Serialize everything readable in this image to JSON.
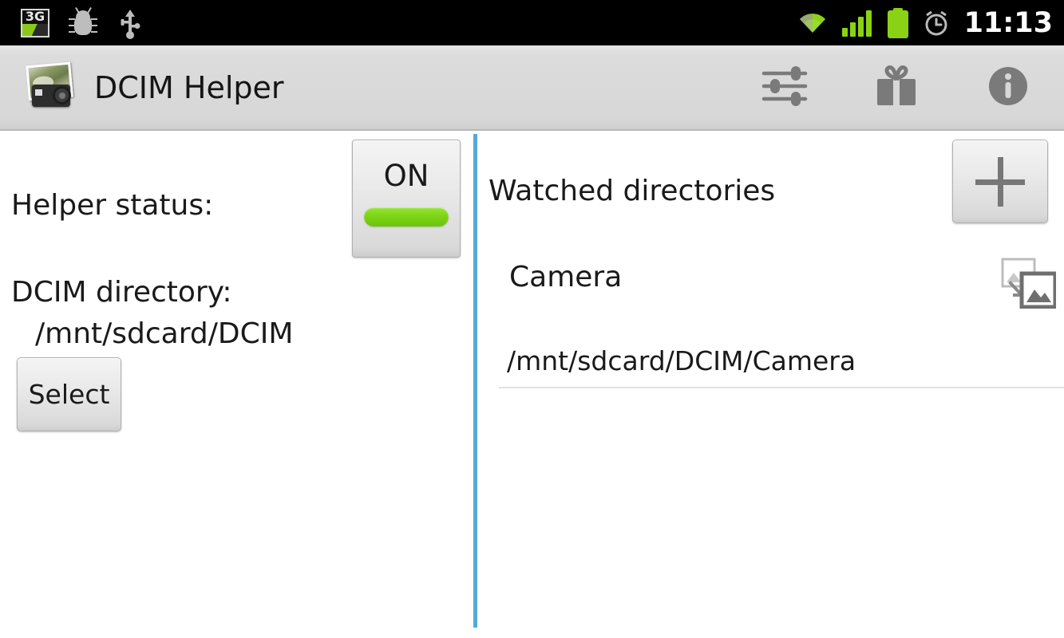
{
  "status_bar": {
    "time": "11:13",
    "left_icons": [
      {
        "name": "3g-icon",
        "label": "3G"
      },
      {
        "name": "android-debug-icon",
        "label": ""
      },
      {
        "name": "usb-icon",
        "label": ""
      }
    ],
    "right_icons": [
      {
        "name": "wifi-icon",
        "label": ""
      },
      {
        "name": "cell-signal-icon",
        "label": ""
      },
      {
        "name": "battery-icon",
        "label": ""
      },
      {
        "name": "alarm-clock-icon",
        "label": ""
      }
    ],
    "colors": {
      "background": "#000000",
      "accent_green": "#8bd215",
      "text": "#ffffff"
    }
  },
  "action_bar": {
    "title": "DCIM Helper",
    "app_icon_name": "photo-camera-icon",
    "actions": [
      {
        "name": "settings-sliders-icon",
        "label": "Settings"
      },
      {
        "name": "gift-icon",
        "label": "Donate"
      },
      {
        "name": "info-icon",
        "label": "About"
      }
    ],
    "colors": {
      "background": "#d7d7d7",
      "title_text": "#151515",
      "icon": "#7a7a7a"
    }
  },
  "left_pane": {
    "helper_status_label": "Helper status:",
    "dcim_directory_label": "DCIM directory:",
    "dcim_directory_value": "/mnt/sdcard/DCIM",
    "select_button_label": "Select"
  },
  "toggle": {
    "state_label": "ON",
    "is_on": true,
    "on_color": "#7fd617"
  },
  "right_pane": {
    "header": "Watched directories",
    "add_button_name": "add-directory-button",
    "directories": [
      {
        "name": "Camera",
        "path": "/mnt/sdcard/DCIM/Camera",
        "action_icon_name": "move-images-icon"
      }
    ]
  },
  "divider": {
    "color": "#56a9d6"
  }
}
